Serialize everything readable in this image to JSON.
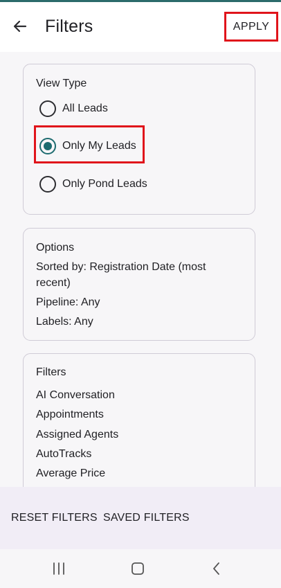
{
  "header": {
    "title": "Filters",
    "apply_label": "APPLY",
    "back_icon": "arrow-left-icon"
  },
  "view_type": {
    "title": "View Type",
    "options": [
      {
        "label": "All Leads",
        "selected": false
      },
      {
        "label": "Only My Leads",
        "selected": true
      },
      {
        "label": "Only Pond Leads",
        "selected": false
      }
    ]
  },
  "options": {
    "title": "Options",
    "sorted_by_line1": "Sorted by: Registration Date (most",
    "sorted_by_line2": "recent)",
    "pipeline": "Pipeline: Any",
    "labels": "Labels: Any"
  },
  "filters": {
    "title": "Filters",
    "items": [
      "AI Conversation",
      "Appointments",
      "Assigned Agents",
      "AutoTracks",
      "Average Price"
    ]
  },
  "footer": {
    "reset_label": "RESET FILTERS",
    "saved_label": "SAVED FILTERS"
  },
  "colors": {
    "accent": "#1d6b6f",
    "highlight": "#e0141b",
    "bottom_bar": "#f1edf6"
  }
}
